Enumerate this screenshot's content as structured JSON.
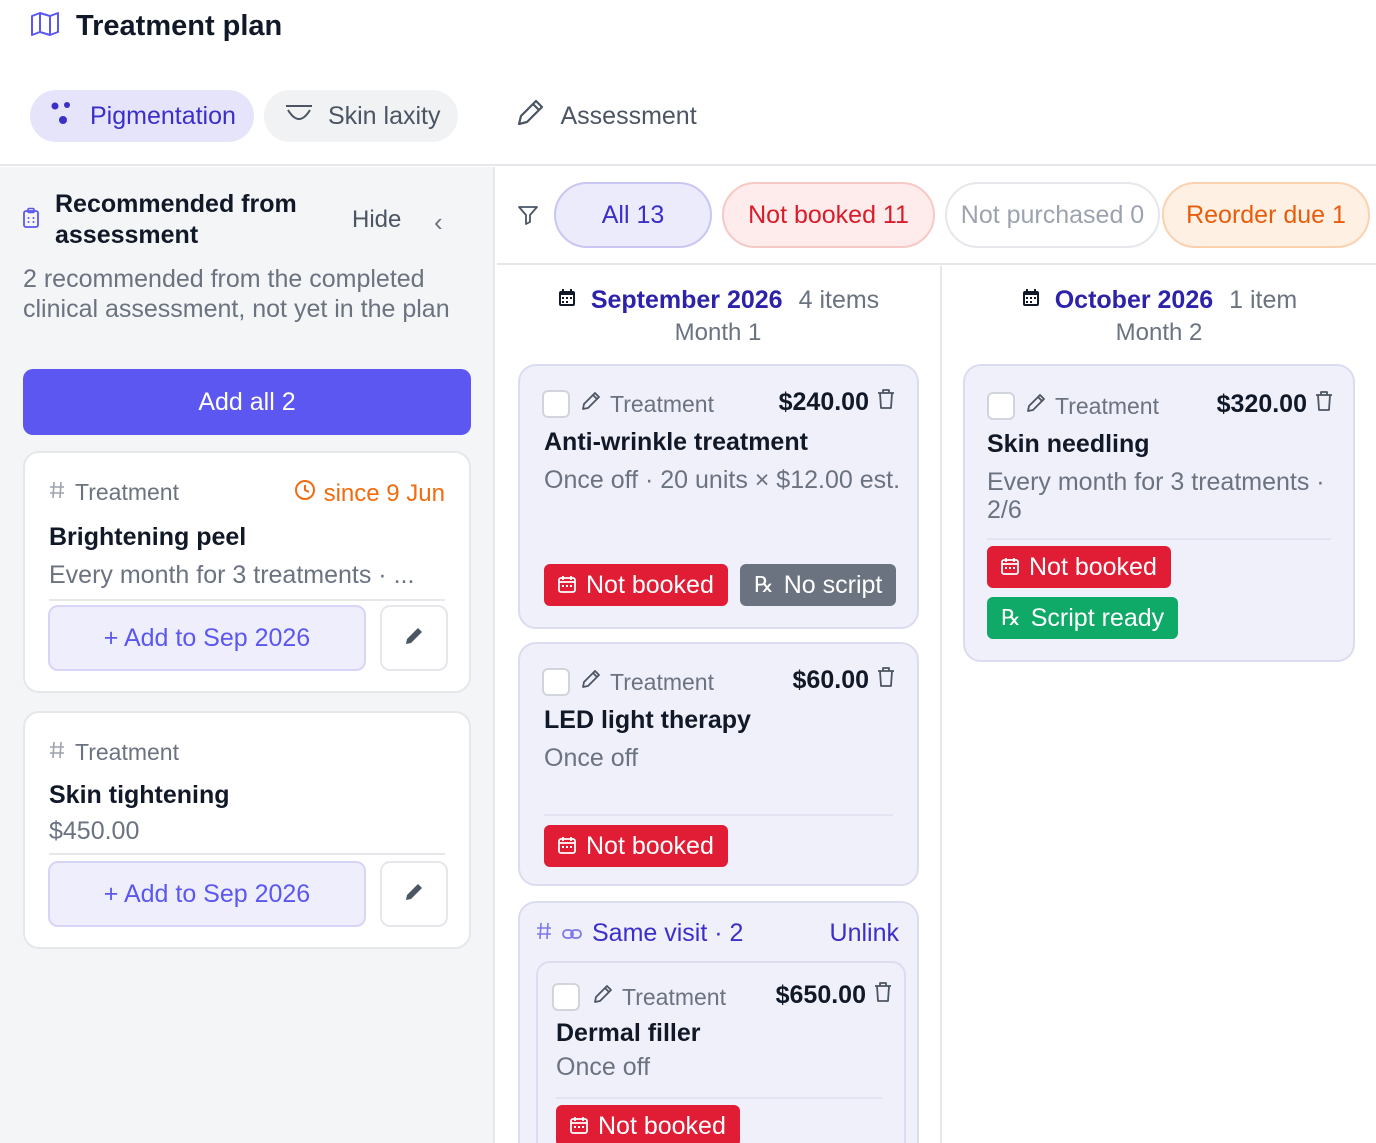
{
  "header": {
    "title": "Treatment plan",
    "title_icon": "map-icon",
    "tabs": [
      {
        "label": "Pigmentation",
        "icon": "dots-icon",
        "active": true
      },
      {
        "label": "Skin laxity",
        "icon": "curve-icon",
        "active": false
      },
      {
        "label": "Assessment",
        "icon": "pencil-icon",
        "active": false
      }
    ]
  },
  "recommended": {
    "title": "Recommended from assessment",
    "hide_label": "Hide",
    "description": "2 recommended from the completed clinical assessment, not yet in the plan",
    "add_all_label": "Add all 2",
    "items": [
      {
        "type": "Treatment",
        "since": "since 9 Jun",
        "name": "Brightening peel",
        "detail": "Every month for 3 treatments · ...",
        "add_label": "+ Add to Sep 2026"
      },
      {
        "type": "Treatment",
        "since": "",
        "name": "Skin tightening",
        "detail": "$450.00",
        "add_label": "+ Add to Sep 2026"
      }
    ]
  },
  "filters": [
    {
      "label": "All 13",
      "color": "#3b2fc9"
    },
    {
      "label": "Not booked 11",
      "color": "#d91c2a"
    },
    {
      "label": "Not purchased 0",
      "color": "#9ca3af"
    },
    {
      "label": "Reorder due 1",
      "color": "#e85d0c"
    }
  ],
  "months": [
    {
      "name": "September 2026",
      "count": "4 items",
      "sub": "Month 1",
      "cards": [
        {
          "type": "Treatment",
          "price": "$240.00",
          "name": "Anti-wrinkle treatment",
          "detail": "Once off · 20 units × $12.00 est.",
          "badges": [
            "Not booked",
            "No script"
          ]
        },
        {
          "type": "Treatment",
          "price": "$60.00",
          "name": "LED light therapy",
          "detail": "Once off",
          "badges": [
            "Not booked"
          ]
        }
      ],
      "group": {
        "label": "Same visit · 2",
        "unlink_label": "Unlink",
        "card": {
          "type": "Treatment",
          "price": "$650.00",
          "name": "Dermal filler",
          "detail": "Once off",
          "badges": [
            "Not booked"
          ]
        }
      }
    },
    {
      "name": "October 2026",
      "count": "1 item",
      "sub": "Month 2",
      "cards": [
        {
          "type": "Treatment",
          "price": "$320.00",
          "name": "Skin needling",
          "detail_line1": "Every month for 3 treatments ·",
          "detail_line2": "2/6",
          "badges": [
            "Not booked",
            "Script ready"
          ]
        }
      ]
    }
  ],
  "colors": {
    "accent": "#5b57f0",
    "not_booked": "#e11d35",
    "no_script": "#6b7280",
    "script_ready": "#0fa968",
    "since": "#f26b0f"
  }
}
